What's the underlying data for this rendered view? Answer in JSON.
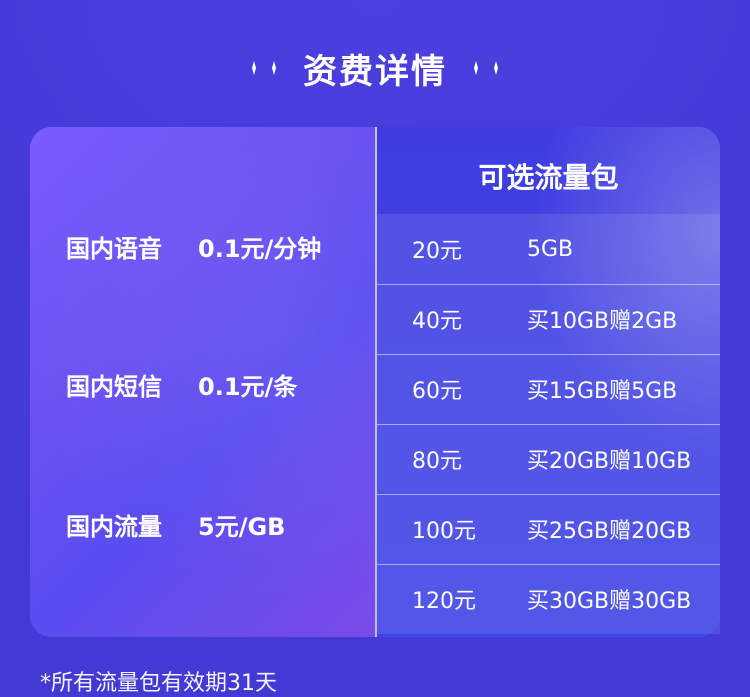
{
  "header": {
    "title": "资费详情",
    "left_decor": "sparkle-pair-icon",
    "right_decor": "sparkle-pair-icon"
  },
  "pricing": [
    {
      "name": "国内语音",
      "price": "0.1元/分钟"
    },
    {
      "name": "国内短信",
      "price": "0.1元/条"
    },
    {
      "name": "国内流量",
      "price": "5元/GB"
    }
  ],
  "packages": {
    "title": "可选流量包",
    "items": [
      {
        "price": "20元",
        "amount": "5GB"
      },
      {
        "price": "40元",
        "amount": "买10GB赠2GB"
      },
      {
        "price": "60元",
        "amount": "买15GB赠5GB"
      },
      {
        "price": "80元",
        "amount": "买20GB赠10GB"
      },
      {
        "price": "100元",
        "amount": "买25GB赠20GB"
      },
      {
        "price": "120元",
        "amount": "买30GB赠30GB"
      }
    ]
  },
  "footnote": "*所有流量包有效期31天",
  "colors": {
    "background": "#4a3fdc",
    "text": "#ffffff",
    "accent": "#6a52f2"
  }
}
